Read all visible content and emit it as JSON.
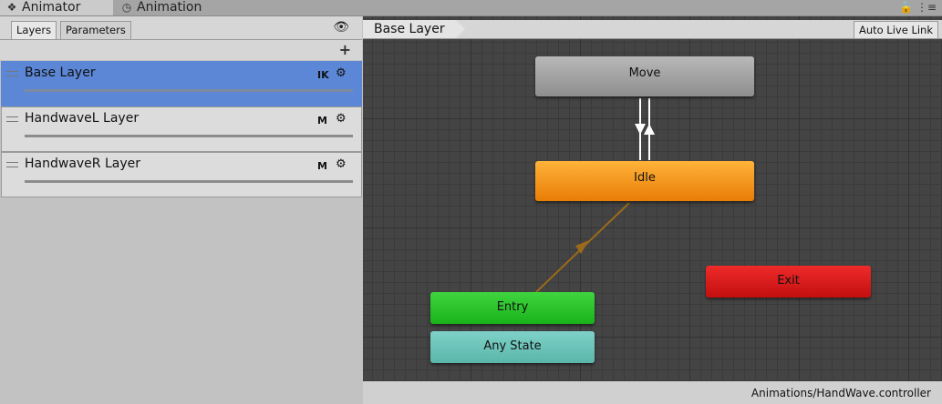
{
  "window_tabs": [
    {
      "label": "Animator",
      "icon": "animator-icon"
    },
    {
      "label": "Animation",
      "icon": "clock-icon"
    }
  ],
  "left_panel": {
    "tabs": [
      "Layers",
      "Parameters"
    ],
    "layers": [
      {
        "name": "Base Layer",
        "badge": "IK",
        "selected": true
      },
      {
        "name": "HandwaveL Layer",
        "badge": "M",
        "selected": false
      },
      {
        "name": "HandwaveR Layer",
        "badge": "M",
        "selected": false
      }
    ]
  },
  "graph": {
    "breadcrumb": "Base Layer",
    "auto_live_link": "Auto Live Link",
    "states": {
      "move": "Move",
      "idle": "Idle",
      "exit": "Exit",
      "entry": "Entry",
      "any_state": "Any State"
    },
    "controller_path": "Animations/HandWave.controller"
  },
  "colors": {
    "selected_layer": "#5b87d6",
    "move_state": "#a3a3a3",
    "idle_state": "#f39a1f",
    "exit_state": "#d81d1d",
    "entry_state": "#2ec42e",
    "any_state": "#6cc4b9",
    "entry_transition": "#9a6a1a",
    "graph_bg": "#444444"
  }
}
